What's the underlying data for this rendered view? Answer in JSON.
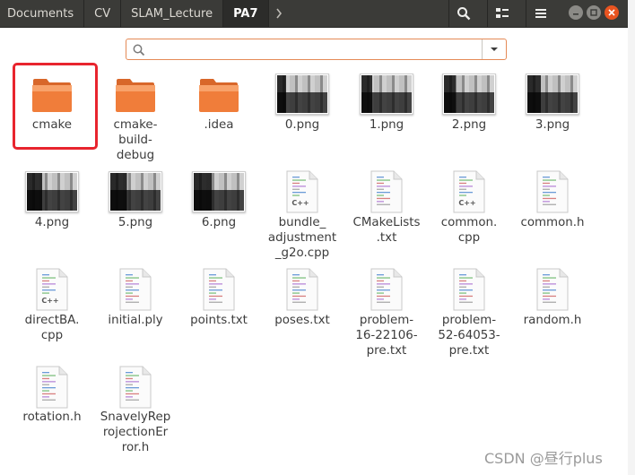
{
  "breadcrumbs": [
    "Documents",
    "CV",
    "SLAM_Lecture",
    "PA7"
  ],
  "search": {
    "placeholder": "",
    "value": ""
  },
  "files": [
    {
      "name": "cmake",
      "kind": "folder"
    },
    {
      "name": "cmake-\nbuild-\ndebug",
      "kind": "folder"
    },
    {
      "name": ".idea",
      "kind": "folder"
    },
    {
      "name": "0.png",
      "kind": "image"
    },
    {
      "name": "1.png",
      "kind": "image"
    },
    {
      "name": "2.png",
      "kind": "image"
    },
    {
      "name": "3.png",
      "kind": "image"
    },
    {
      "name": "4.png",
      "kind": "image"
    },
    {
      "name": "5.png",
      "kind": "image"
    },
    {
      "name": "6.png",
      "kind": "image"
    },
    {
      "name": "bundle_\nadjustment\n_g2o.cpp",
      "kind": "cpp"
    },
    {
      "name": "CMakeLists\n.txt",
      "kind": "text"
    },
    {
      "name": "common.\ncpp",
      "kind": "cpp"
    },
    {
      "name": "common.h",
      "kind": "text"
    },
    {
      "name": "directBA.\ncpp",
      "kind": "cpp"
    },
    {
      "name": "initial.ply",
      "kind": "text"
    },
    {
      "name": "points.txt",
      "kind": "text"
    },
    {
      "name": "poses.txt",
      "kind": "text"
    },
    {
      "name": "problem-\n16-22106-\npre.txt",
      "kind": "text"
    },
    {
      "name": "problem-\n52-64053-\npre.txt",
      "kind": "text"
    },
    {
      "name": "random.h",
      "kind": "text"
    },
    {
      "name": "rotation.h",
      "kind": "text"
    },
    {
      "name": "SnavelyRep\nrojectionEr\nror.h",
      "kind": "text"
    }
  ],
  "watermark": "CSDN @昼行plus",
  "colors": {
    "header": "#3b3b38",
    "accent": "#e58a56",
    "folder": "#f07d3a",
    "highlight": "#e8242e"
  },
  "icons": {
    "search": "search-icon",
    "view": "view-toggle-icon",
    "menu": "hamburger-menu-icon",
    "minimize": "minimize-icon",
    "maximize": "maximize-icon",
    "close": "close-icon"
  }
}
